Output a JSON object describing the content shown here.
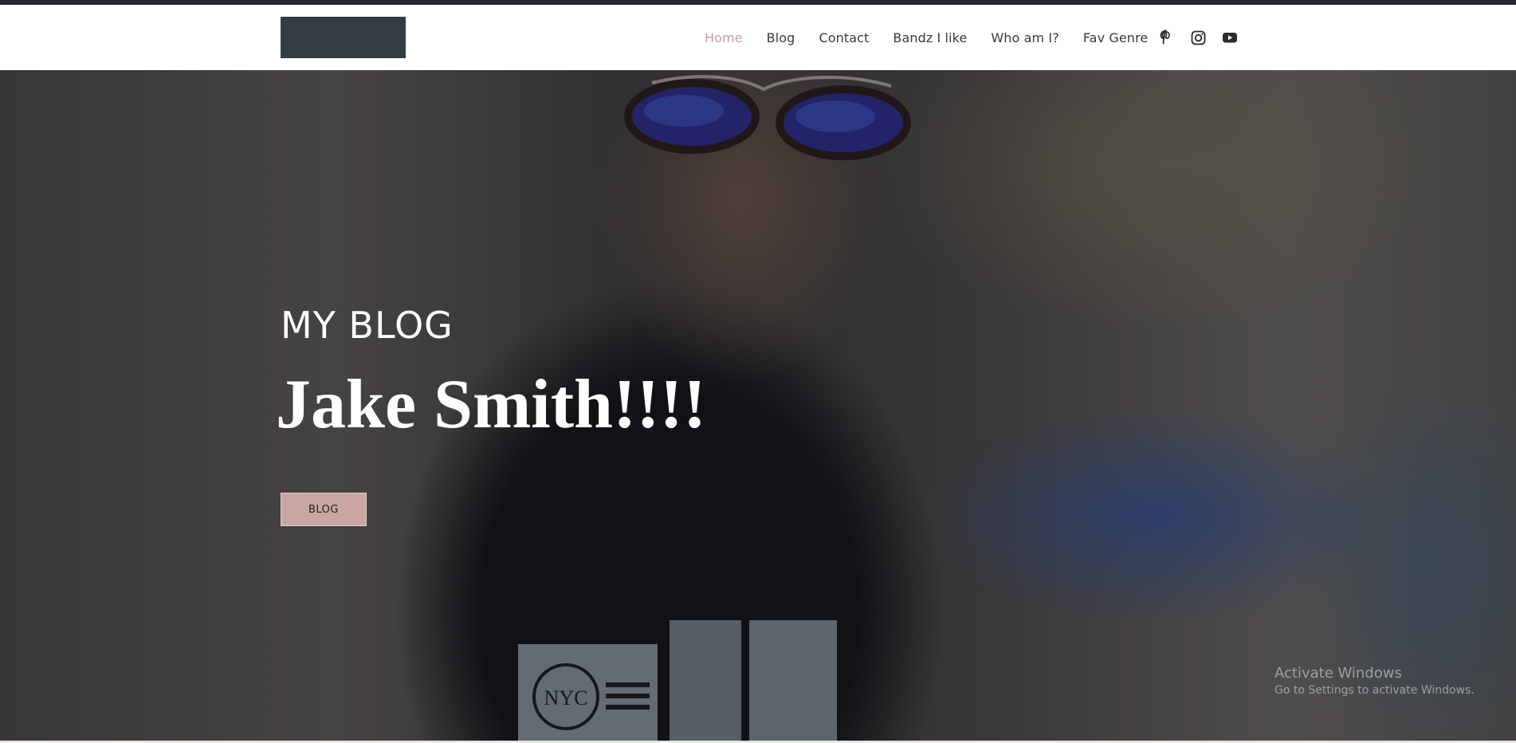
{
  "nav": {
    "items": [
      {
        "label": "Home",
        "active": true
      },
      {
        "label": "Blog",
        "active": false
      },
      {
        "label": "Contact",
        "active": false
      },
      {
        "label": "Bandz I like",
        "active": false
      },
      {
        "label": "Who am I?",
        "active": false
      },
      {
        "label": "Fav Genre",
        "active": false
      }
    ],
    "active_color": "#c4a09c",
    "text_color": "#3a3a3a"
  },
  "social": {
    "icons": [
      "pinterest-icon",
      "instagram-icon",
      "youtube-icon"
    ]
  },
  "hero": {
    "eyebrow": "MY BLOG",
    "title": "Jake Smith!!!!",
    "button_label": "BLOG",
    "button_color": "#c9a6a3",
    "tee_print": "NYC"
  },
  "watermark": {
    "title": "Activate Windows",
    "subtitle": "Go to Settings to activate Windows."
  }
}
